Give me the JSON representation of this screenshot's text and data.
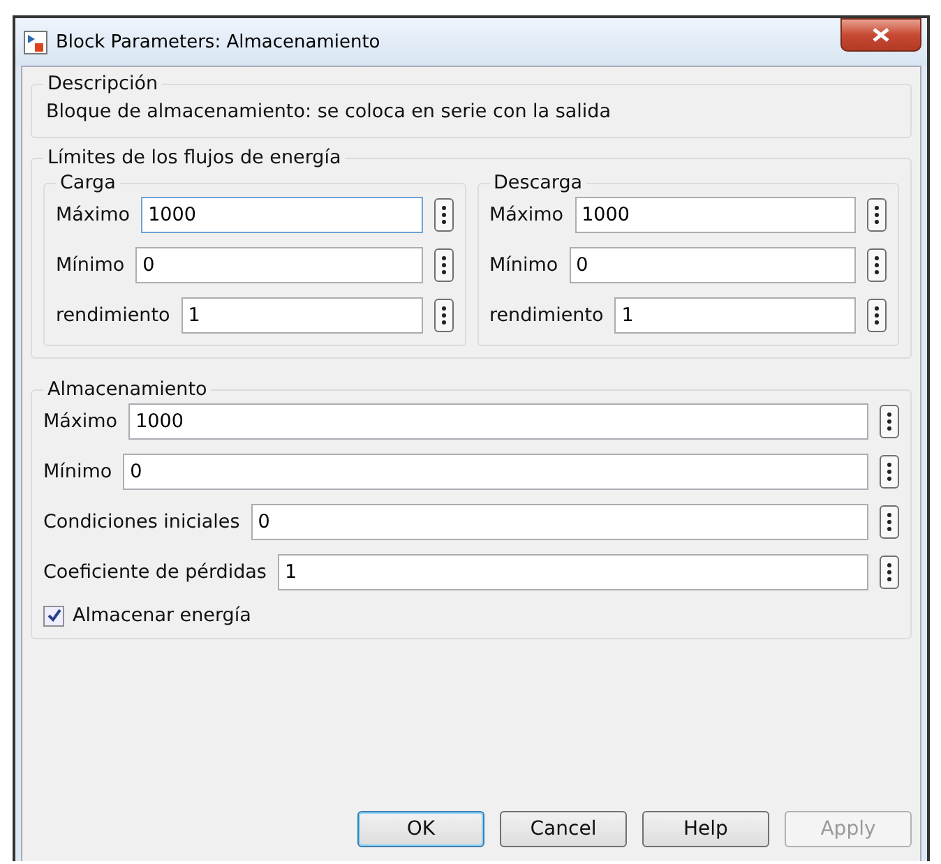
{
  "window": {
    "title": "Block Parameters: Almacenamiento"
  },
  "description": {
    "title": "Descripción",
    "text": "Bloque de almacenamiento: se coloca en serie con la salida"
  },
  "limits": {
    "title": "Límites de los flujos de energía",
    "groups": [
      {
        "title": "Carga",
        "params": [
          {
            "label": "Máximo",
            "value": "1000",
            "focused": true
          },
          {
            "label": "Mínimo",
            "value": "0",
            "focused": false
          },
          {
            "label": "rendimiento",
            "value": "1",
            "focused": false
          }
        ]
      },
      {
        "title": "Descarga",
        "params": [
          {
            "label": "Máximo",
            "value": "1000",
            "focused": false
          },
          {
            "label": "Mínimo",
            "value": "0",
            "focused": false
          },
          {
            "label": "rendimiento",
            "value": "1",
            "focused": false
          }
        ]
      }
    ]
  },
  "storage": {
    "title": "Almacenamiento",
    "params": [
      {
        "label": "Máximo",
        "value": "1000",
        "focused": false
      },
      {
        "label": "Mínimo",
        "value": "0",
        "focused": false
      },
      {
        "label": "Condiciones iniciales",
        "value": "0",
        "focused": false
      },
      {
        "label": "Coeficiente de pérdidas",
        "value": "1",
        "focused": false
      }
    ],
    "checkbox": {
      "label": "Almacenar energía",
      "checked": true
    }
  },
  "buttons": [
    {
      "label": "OK",
      "default": true,
      "disabled": false
    },
    {
      "label": "Cancel",
      "default": false,
      "disabled": false
    },
    {
      "label": "Help",
      "default": false,
      "disabled": false
    },
    {
      "label": "Apply",
      "default": false,
      "disabled": true
    }
  ]
}
